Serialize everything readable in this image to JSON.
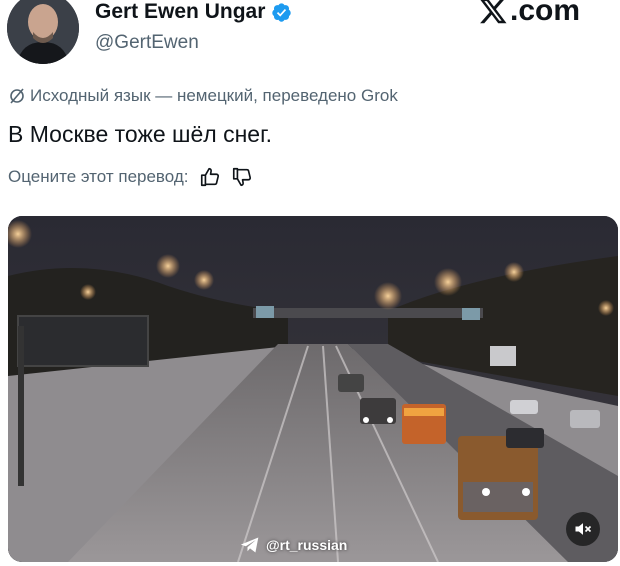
{
  "author": {
    "display_name": "Gert Ewen Ungar",
    "handle": "@GertEwen",
    "avatar_icon": "portrait-avatar",
    "verified_icon": "verified-badge-icon",
    "verified_color": "#1d9bf0"
  },
  "brand": {
    "logo_text": ".com",
    "logo_icon": "x-logo-icon"
  },
  "translation": {
    "notice": "Исходный язык — немецкий, переведено Grok",
    "notice_icon": "translate-slash-icon"
  },
  "tweet": {
    "text": "В Москве тоже шёл снег."
  },
  "rating": {
    "prompt": "Оцените этот перевод:",
    "thumbs_up_icon": "thumbs-up-icon",
    "thumbs_down_icon": "thumbs-down-icon"
  },
  "media": {
    "description_icon": "snowy-highway-night-video",
    "watermark": "@rt_russian",
    "watermark_icon": "telegram-icon",
    "mute_icon": "speaker-muted-icon"
  },
  "colors": {
    "text_primary": "#0f1419",
    "text_secondary": "#536471",
    "accent": "#1d9bf0"
  }
}
